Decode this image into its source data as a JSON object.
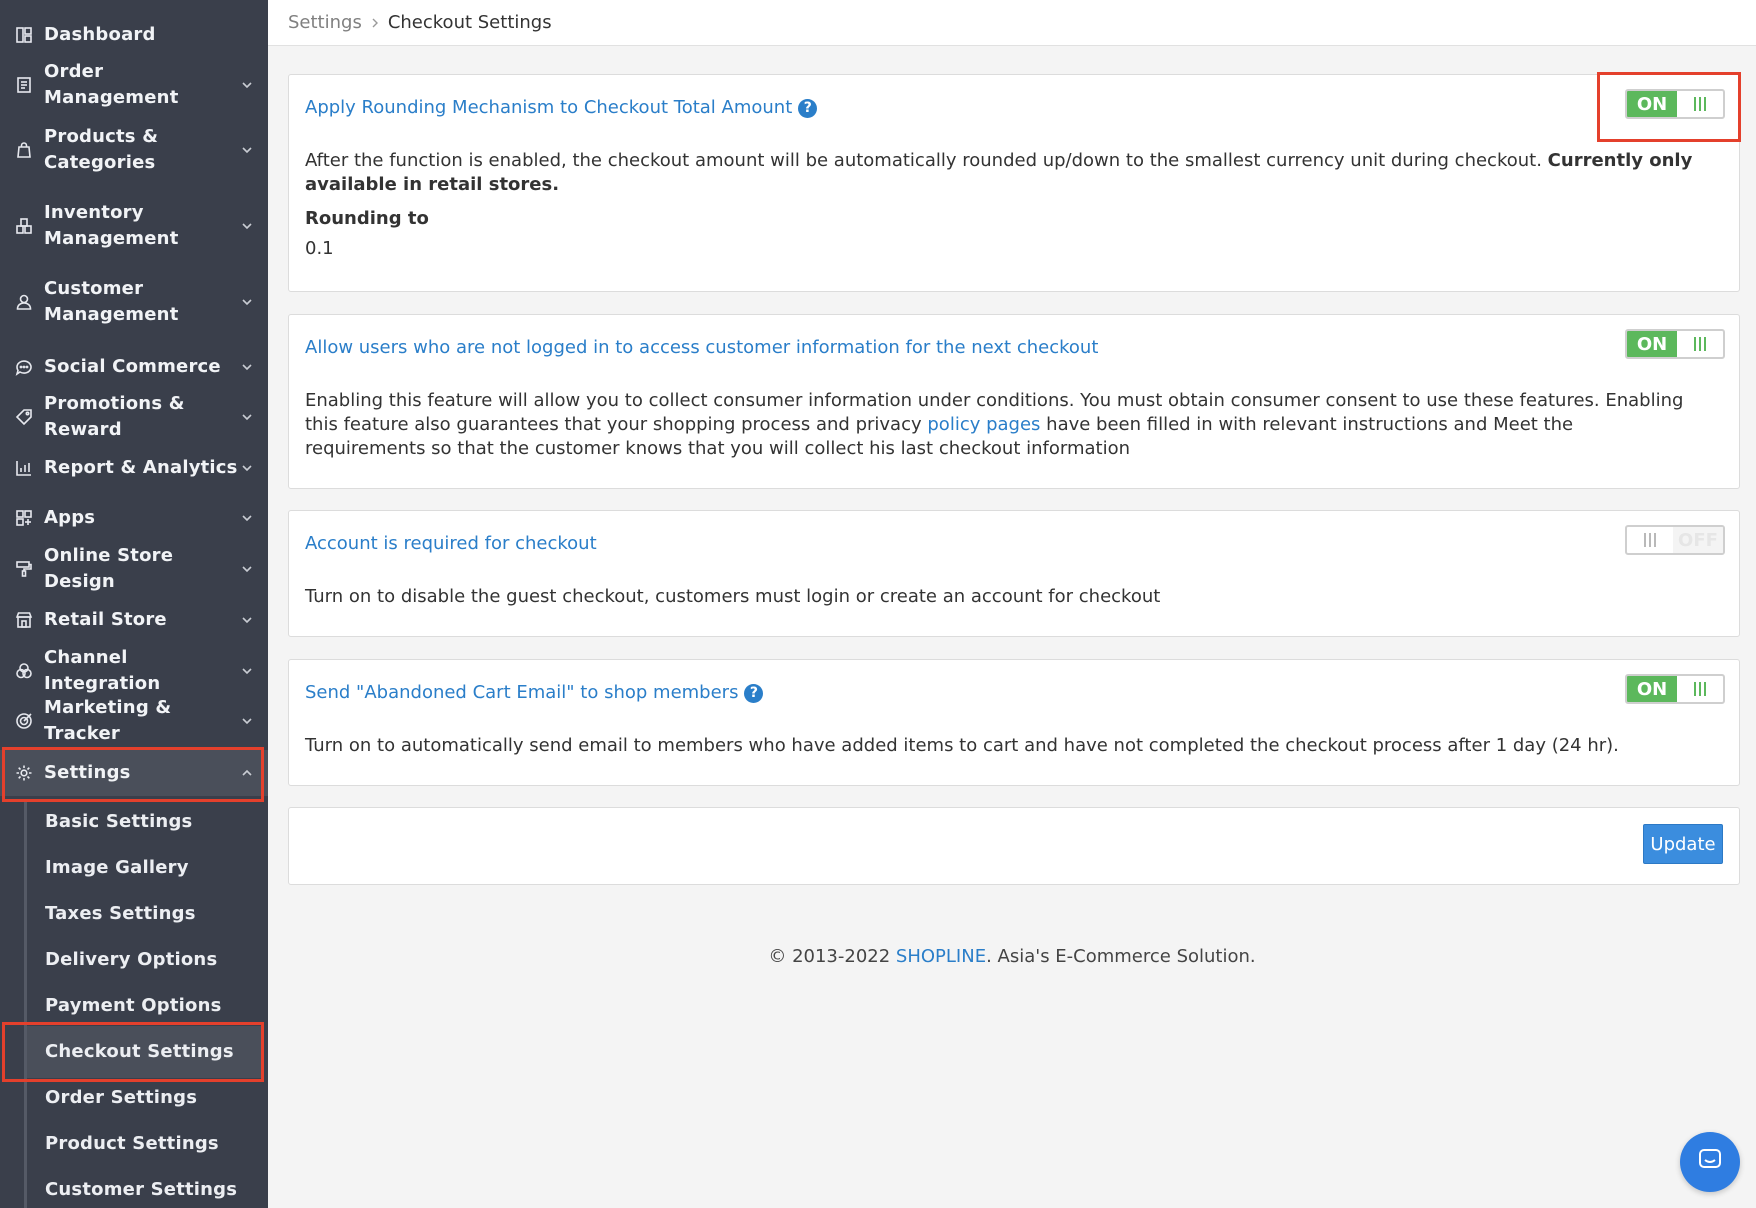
{
  "sidebar": {
    "items": [
      {
        "label": "Dashboard",
        "icon": "dashboard-icon"
      },
      {
        "label": "Order Management",
        "icon": "order-icon"
      },
      {
        "label": "Products &\nCategories",
        "icon": "bag-icon"
      },
      {
        "label": "Inventory\nManagement",
        "icon": "inventory-icon"
      },
      {
        "label": "Customer\nManagement",
        "icon": "user-icon"
      },
      {
        "label": "Social Commerce",
        "icon": "chat-bubble-icon"
      },
      {
        "label": "Promotions & Reward",
        "icon": "tag-icon"
      },
      {
        "label": "Report & Analytics",
        "icon": "chart-icon"
      },
      {
        "label": "Apps",
        "icon": "apps-icon"
      },
      {
        "label": "Online Store Design",
        "icon": "paint-roller-icon"
      },
      {
        "label": "Retail Store",
        "icon": "store-icon"
      },
      {
        "label": "Channel Integration",
        "icon": "channel-icon"
      },
      {
        "label": "Marketing & Tracker",
        "icon": "target-icon"
      },
      {
        "label": "Settings",
        "icon": "gear-icon"
      }
    ],
    "sub_items": [
      "Basic Settings",
      "Image Gallery",
      "Taxes Settings",
      "Delivery Options",
      "Payment Options",
      "Checkout Settings",
      "Order Settings",
      "Product Settings",
      "Customer Settings"
    ]
  },
  "breadcrumb": {
    "parent": "Settings",
    "current": "Checkout Settings"
  },
  "cards": [
    {
      "title": "Apply Rounding Mechanism to Checkout Total Amount",
      "description": "After the function is enabled, the checkout amount will be automatically rounded up/down to the smallest currency unit during checkout.",
      "description_bold": "Currently only available in retail stores.",
      "field_label": "Rounding to",
      "field_value": "0.1",
      "toggle": "ON"
    },
    {
      "title": "Allow users who are not logged in to access customer information for the next checkout",
      "description_part1": "Enabling this feature will allow you to collect consumer information under conditions. You must obtain consumer consent to use these features. Enabling this feature also guarantees that your shopping process and privacy",
      "description_link": "policy pages",
      "description_part2": "have been filled in with relevant instructions and Meet the requirements so that the customer knows that you will collect his last checkout information",
      "toggle": "ON"
    },
    {
      "title": "Account is required for checkout",
      "description": "Turn on to disable the guest checkout, customers must login or create an account for checkout",
      "toggle": "OFF"
    },
    {
      "title": "Send \"Abandoned Cart Email\" to shop members",
      "description": "Turn on to automatically send email to members who have added items to cart and have not completed the checkout process after 1 day (24 hr).",
      "toggle": "ON"
    }
  ],
  "update_label": "Update",
  "footer": {
    "prefix": "© 2013-2022 ",
    "brand": "SHOPLINE",
    "suffix": ". Asia's E-Commerce Solution."
  },
  "help_glyph": "?",
  "colors": {
    "accent": "#2a7ec9",
    "toggle_on": "#5cb85c",
    "sidebar_bg": "#3a3f4b",
    "highlight": "#e4402c",
    "button": "#3b8dde"
  }
}
